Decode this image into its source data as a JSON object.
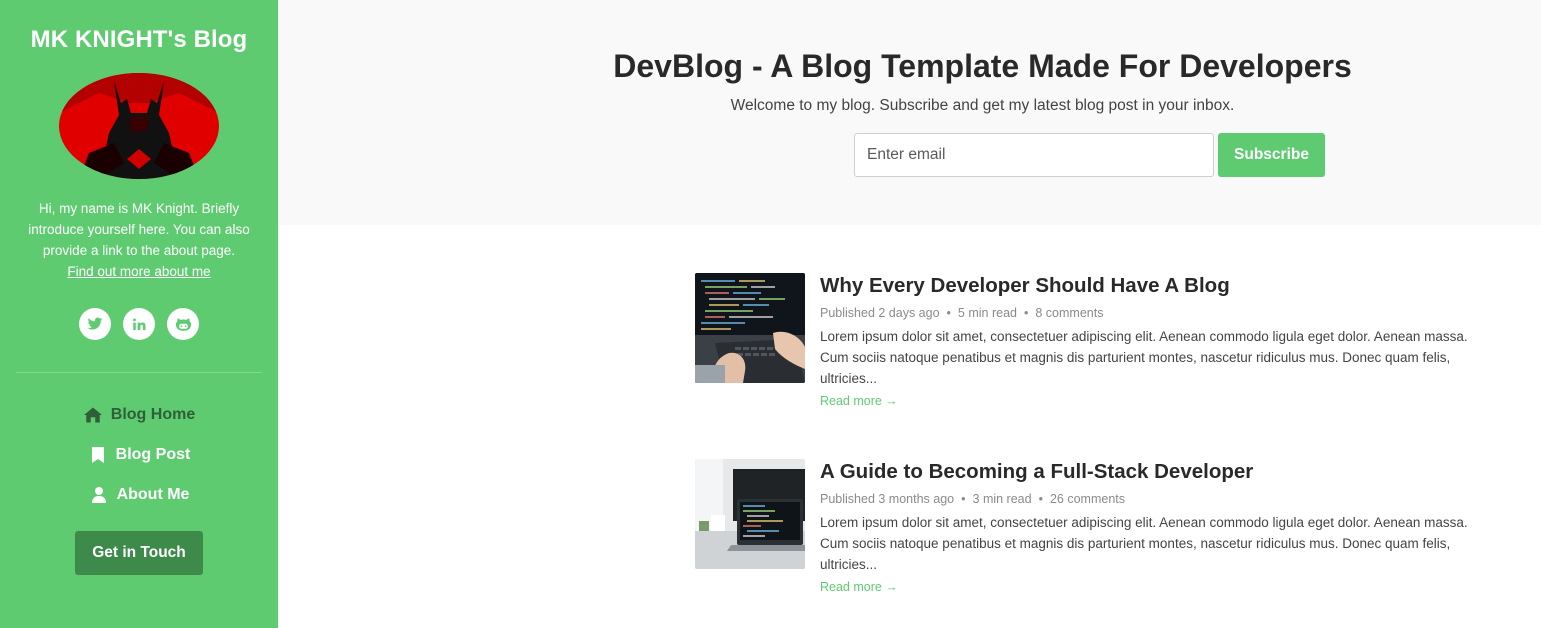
{
  "sidebar": {
    "blog_name": "MK KNIGHT's Blog",
    "bio_text": "Hi, my name is MK Knight. Briefly introduce yourself here. You can also provide a link to the about page.",
    "bio_link": "Find out more about me",
    "social_icons": [
      "twitter-icon",
      "linkedin-icon",
      "github-icon"
    ],
    "nav": [
      {
        "label": "Blog Home",
        "icon": "home-icon",
        "active": true
      },
      {
        "label": "Blog Post",
        "icon": "bookmark-icon",
        "active": false
      },
      {
        "label": "About Me",
        "icon": "user-icon",
        "active": false
      }
    ],
    "cta_label": "Get in Touch"
  },
  "header": {
    "title": "DevBlog - A Blog Template Made For Developers",
    "subtitle": "Welcome to my blog. Subscribe and get my latest blog post in your inbox.",
    "email_placeholder": "Enter email",
    "subscribe_label": "Subscribe"
  },
  "posts": [
    {
      "title": "Why Every Developer Should Have A Blog",
      "published": "Published 2 days ago",
      "read_time": "5 min read",
      "comments": "8 comments",
      "excerpt": "Lorem ipsum dolor sit amet, consectetuer adipiscing elit. Aenean commodo ligula eget dolor. Aenean massa. Cum sociis natoque penatibus et magnis dis parturient montes, nascetur ridiculus mus. Donec quam felis, ultricies...",
      "read_more": "Read more →"
    },
    {
      "title": "A Guide to Becoming a Full-Stack Developer",
      "published": "Published 3 months ago",
      "read_time": "3 min read",
      "comments": "26 comments",
      "excerpt": "Lorem ipsum dolor sit amet, consectetuer adipiscing elit. Aenean commodo ligula eget dolor. Aenean massa. Cum sociis natoque penatibus et magnis dis parturient montes, nascetur ridiculus mus. Donec quam felis, ultricies...",
      "read_more": "Read more →"
    }
  ],
  "colors": {
    "brand_green": "#5fcb71",
    "cta_green": "#3d8a4a",
    "active_nav": "#2f5f37"
  }
}
